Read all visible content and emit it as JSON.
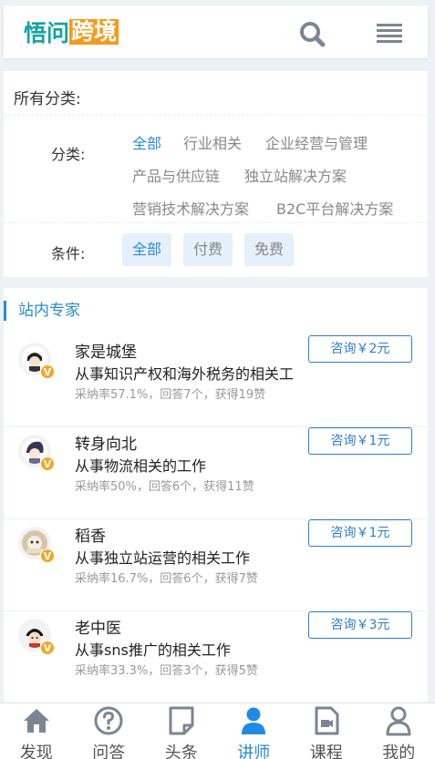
{
  "header": {
    "logo_part1": "悟问",
    "logo_part2": "跨境",
    "colors": {
      "logo_teal": "#14a3a3",
      "logo_orange": "#f59a1b"
    }
  },
  "filter": {
    "all_label": "所有分类:",
    "category_label": "分类:",
    "categories": [
      "全部",
      "行业相关",
      "企业经营与管理",
      "产品与供应链",
      "独立站解决方案",
      "营销技术解决方案",
      "B2C平台解决方案"
    ],
    "selected_category": "全部",
    "condition_label": "条件:",
    "conditions": [
      "全部",
      "付费",
      "免费"
    ],
    "selected_condition": "全部"
  },
  "experts": {
    "section_title": "站内专家",
    "list": [
      {
        "name": "家是城堡",
        "desc": "从事知识产权和海外税务的相关工",
        "stats": "采纳率57.1%，回答7个，获得19赞",
        "consult": "咨询￥2元"
      },
      {
        "name": "转身向北",
        "desc": "从事物流相关的工作",
        "stats": "采纳率50%，回答6个，获得11赞",
        "consult": "咨询￥1元"
      },
      {
        "name": "稻香",
        "desc": "从事独立站运营的相关工作",
        "stats": "采纳率16.7%，回答6个，获得7赞",
        "consult": "咨询￥1元"
      },
      {
        "name": "老中医",
        "desc": "从事sns推广的相关工作",
        "stats": "采纳率33.3%，回答3个，获得5赞",
        "consult": "咨询￥3元"
      }
    ],
    "badge": "V"
  },
  "nav": {
    "items": [
      "发现",
      "问答",
      "头条",
      "讲师",
      "课程",
      "我的"
    ],
    "active": "讲师",
    "colors": {
      "active": "#2a8bd6",
      "inactive": "#555555"
    }
  }
}
